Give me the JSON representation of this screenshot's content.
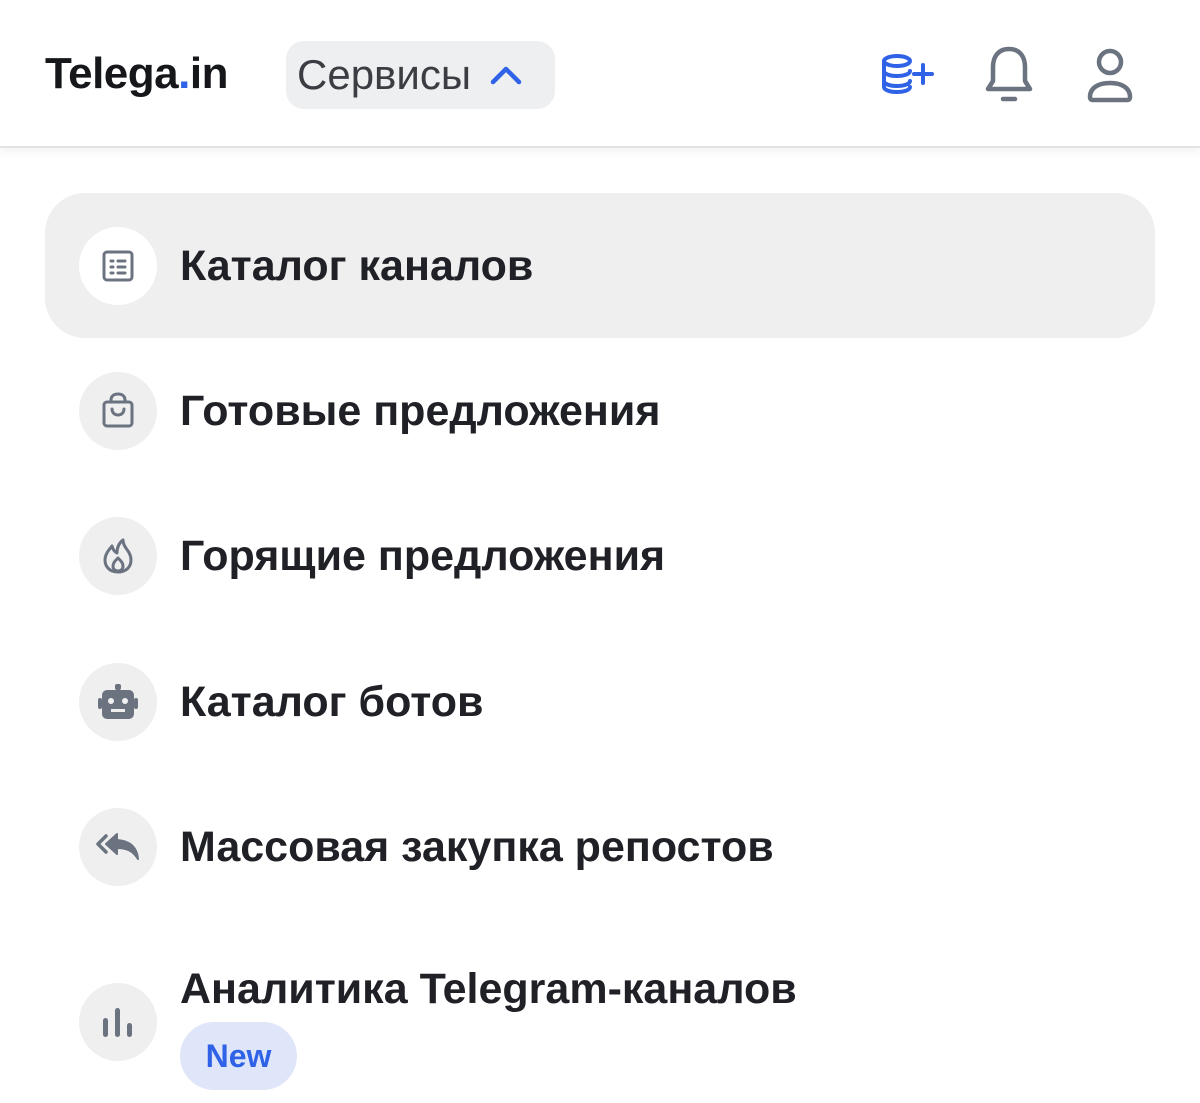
{
  "header": {
    "logo_main": "Telega",
    "logo_dot": ".",
    "logo_suffix": "in",
    "services_label": "Сервисы",
    "icons": [
      "coins-plus-icon",
      "bell-icon",
      "user-icon"
    ]
  },
  "menu": {
    "items": [
      {
        "label": "Каталог каналов",
        "icon": "list-icon",
        "active": true
      },
      {
        "label": "Готовые предложения",
        "icon": "shopping-bag-icon"
      },
      {
        "label": "Горящие предложения",
        "icon": "flame-icon"
      },
      {
        "label": "Каталог ботов",
        "icon": "robot-icon"
      },
      {
        "label": "Массовая закупка репостов",
        "icon": "reply-all-icon"
      },
      {
        "label": "Аналитика Telegram-каналов",
        "icon": "bar-chart-icon",
        "badge": "New"
      }
    ]
  },
  "colors": {
    "accent": "#2f62e6",
    "icon_gray": "#6b7380",
    "active_bg": "#efeff0",
    "badge_bg": "#dfe6f9"
  }
}
